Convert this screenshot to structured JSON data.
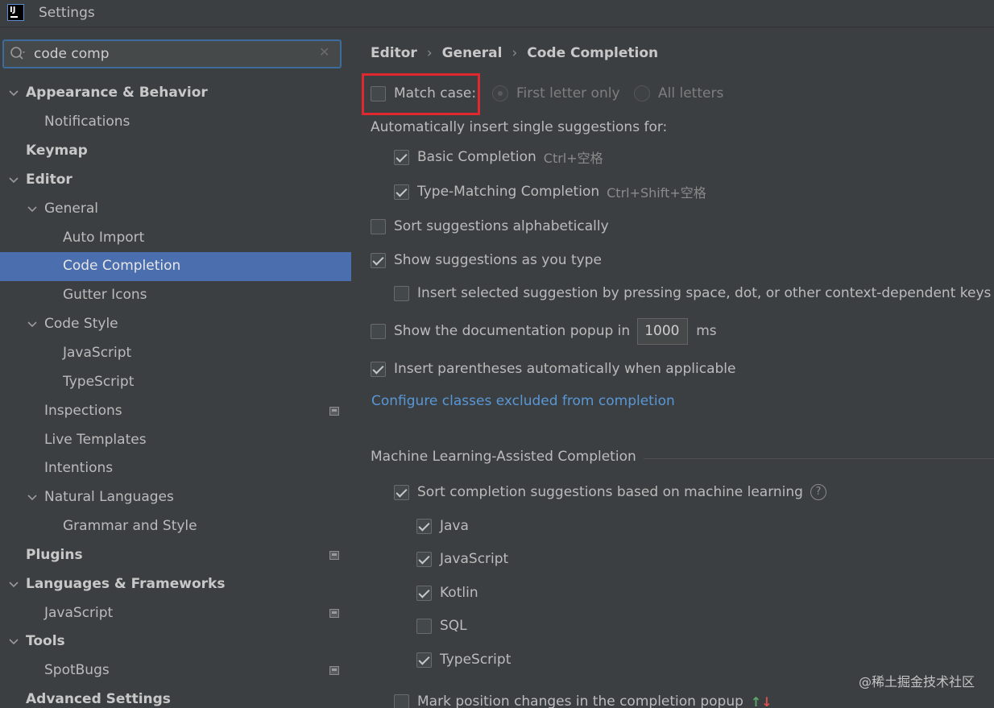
{
  "window": {
    "title": "Settings"
  },
  "search": {
    "value": "code comp"
  },
  "tree": {
    "appearance": "Appearance & Behavior",
    "notifications": "Notifications",
    "keymap": "Keymap",
    "editor": "Editor",
    "general": "General",
    "auto_import": "Auto Import",
    "code_completion": "Code Completion",
    "gutter_icons": "Gutter Icons",
    "code_style": "Code Style",
    "javascript": "JavaScript",
    "typescript": "TypeScript",
    "inspections": "Inspections",
    "live_templates": "Live Templates",
    "intentions": "Intentions",
    "natural_languages": "Natural Languages",
    "grammar": "Grammar and Style",
    "plugins": "Plugins",
    "languages": "Languages & Frameworks",
    "lang_javascript": "JavaScript",
    "tools": "Tools",
    "spotbugs": "SpotBugs",
    "advanced": "Advanced Settings"
  },
  "breadcrumb": [
    "Editor",
    "General",
    "Code Completion"
  ],
  "match_case": {
    "label": "Match case:",
    "checked": false,
    "option_first": "First letter only",
    "option_all": "All letters"
  },
  "auto_insert": {
    "heading": "Automatically insert single suggestions for:",
    "basic": {
      "label": "Basic Completion",
      "shortcut": "Ctrl+空格",
      "checked": true
    },
    "type_matching": {
      "label": "Type-Matching Completion",
      "shortcut": "Ctrl+Shift+空格",
      "checked": true
    }
  },
  "options": {
    "sort_alpha": {
      "label": "Sort suggestions alphabetically",
      "checked": false
    },
    "show_as_type": {
      "label": "Show suggestions as you type",
      "checked": true
    },
    "insert_selected": {
      "label": "Insert selected suggestion by pressing space, dot, or other context-dependent keys",
      "checked": false
    },
    "doc_popup": {
      "label": "Show the documentation popup in",
      "value": "1000",
      "unit": "ms",
      "checked": false
    },
    "parens": {
      "label": "Insert parentheses automatically when applicable",
      "checked": true
    },
    "configure_link": "Configure classes excluded from completion"
  },
  "ml": {
    "title": "Machine Learning-Assisted Completion",
    "sort_ml": {
      "label": "Sort completion suggestions based on machine learning",
      "checked": true
    },
    "help": "?",
    "languages": [
      {
        "label": "Java",
        "checked": true
      },
      {
        "label": "JavaScript",
        "checked": true
      },
      {
        "label": "Kotlin",
        "checked": true
      },
      {
        "label": "SQL",
        "checked": false
      },
      {
        "label": "TypeScript",
        "checked": true
      }
    ],
    "mark_changes": {
      "label": "Mark position changes in the completion popup",
      "checked": false,
      "up": "↑",
      "down": "↓"
    }
  },
  "watermark": "@稀土掘金技术社区",
  "colors": {
    "selection": "#4b6eaf",
    "link": "#5897d6",
    "highlight": "#e0282e"
  }
}
